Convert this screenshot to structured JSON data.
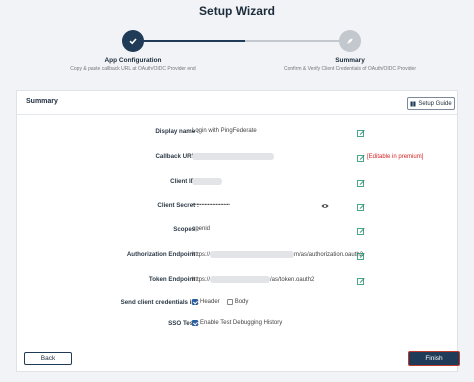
{
  "header": {
    "title": "Setup Wizard"
  },
  "steps": [
    {
      "title": "App Configuration",
      "description": "Copy & paste callback URL at OAuth/OIDC Provider end",
      "status": "active"
    },
    {
      "title": "Summary",
      "description": "Confirm & Verify Client Credentials of OAuth/OIDC Provider",
      "status": "pending"
    }
  ],
  "summary": {
    "title": "Summary",
    "setup_guide_label": "Setup Guide",
    "fields": {
      "display_name": {
        "label": "Display name :",
        "value": "Login with PingFederate"
      },
      "callback_url": {
        "label": "Callback URL :",
        "premium_note": "[Editable in premium]"
      },
      "client_id": {
        "label": "Client ID :"
      },
      "client_secret": {
        "label": "Client Secret :",
        "value": "••••••••••••••••••••••••"
      },
      "scopes": {
        "label": "Scopes :",
        "value": "openid"
      },
      "authorization_endpoint": {
        "label": "Authorization Endpoint :",
        "prefix": "https://",
        "suffix": "m/as/authorization.oauth2"
      },
      "token_endpoint": {
        "label": "Token Endpoint :",
        "prefix": "https://",
        "suffix": "/as/token.oauth2"
      },
      "send_credentials": {
        "label": "Send client credentials in :",
        "options": [
          "Header",
          "Body"
        ],
        "selected": "Header"
      },
      "sso_test": {
        "label": "SSO Test :",
        "checkbox_label": "Enable Test Debugging History",
        "checked": true
      }
    }
  },
  "footer": {
    "back_label": "Back",
    "finish_label": "Finish"
  },
  "colors": {
    "primary": "#1f3b57",
    "inactive": "#c3c8ce",
    "premium": "#d62424",
    "edit_icon": "#1e8f6e"
  }
}
